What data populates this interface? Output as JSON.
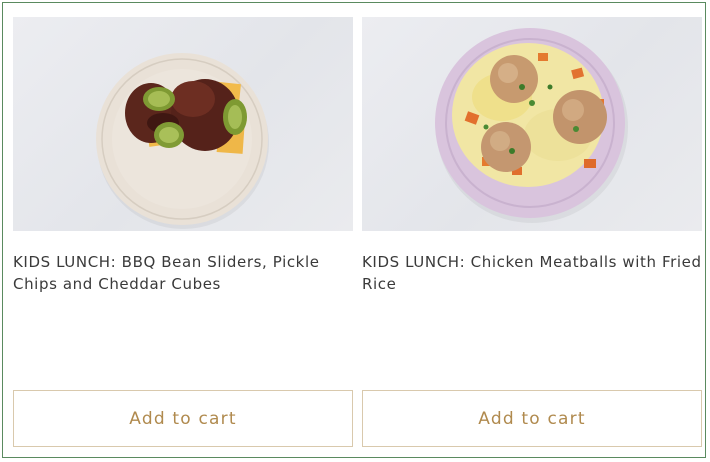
{
  "products": [
    {
      "title": "KIDS LUNCH: BBQ Bean Sliders, Pickle Chips and Cheddar Cubes",
      "button_label": "Add to cart"
    },
    {
      "title": "KIDS LUNCH: Chicken Meatballs with Fried Rice",
      "button_label": "Add to cart"
    }
  ],
  "colors": {
    "frame_border": "#5a8a5f",
    "button_border": "#d9c9ad",
    "button_text": "#b08a4e",
    "title_text": "#3a3a3a"
  }
}
